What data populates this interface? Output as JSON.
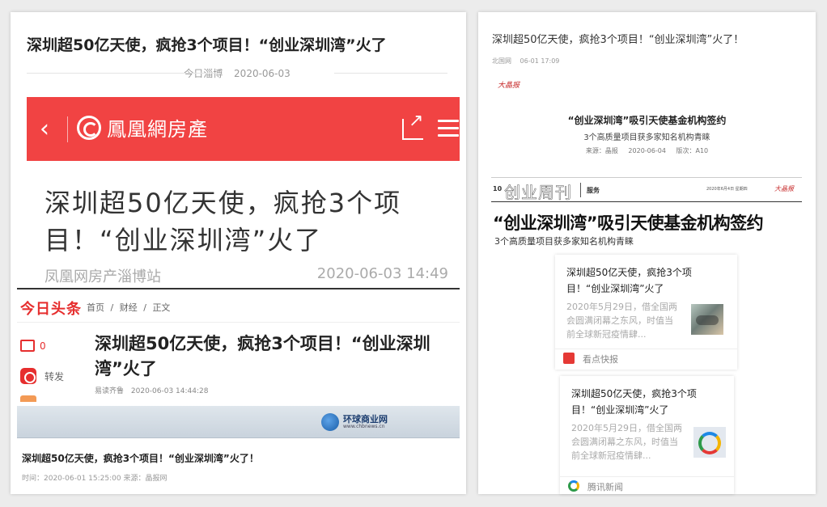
{
  "left": {
    "title": "深圳超50亿天使，疯抢3个项目！“创业深圳湾”火了",
    "source": "今日淄博",
    "date": "2020-06-03",
    "ifeng": {
      "brand": "鳳凰網房產",
      "headline": "深圳超50亿天使，疯抢3个项目！“创业深圳湾”火了",
      "source": "凤凰网房产淄博站",
      "time": "2020-06-03 14:49"
    },
    "toutiao": {
      "brand": "今日头条",
      "crumbs": [
        "首页",
        "/",
        "财经",
        "/",
        "正文"
      ],
      "comment_count": "0",
      "forward_label": "转发",
      "title": "深圳超50亿天使，疯抢3个项目！“创业深圳湾”火了",
      "source": "易读齐鲁",
      "time": "2020-06-03 14:44:28"
    },
    "huanqiu": {
      "logo_name": "环球商业网",
      "logo_url": "www.chbnews.cn",
      "title": "深圳超50亿天使，疯抢3个项目！“创业深圳湾”火了！",
      "meta": "时间：2020-06-01 15:25:00 来源：晶报网"
    }
  },
  "right": {
    "title": "深圳超50亿天使，疯抢3个项目！“创业深圳湾”火了！",
    "meta_source": "北国网",
    "meta_time": "06-01 17:09",
    "logo": "大晶报",
    "head": "“创业深圳湾”吸引天使基金机构签约",
    "sub": "3个高质量项目获多家知名机构青睐",
    "meta1_source": "来源：晶报",
    "meta1_date": "2020-06-04",
    "meta1_page": "版次：A10",
    "newspaper": {
      "page_no": "10",
      "column": "创业周刊",
      "tag": "服务",
      "date_line": "2020年6月4日 星期四",
      "logo": "大晶报",
      "head": "“创业深圳湾”吸引天使基金机构签约",
      "sub": "3个高质量项目获多家知名机构青睐"
    },
    "card_kd": {
      "title": "深圳超50亿天使，疯抢3个项目！“创业深圳湾”火了",
      "body": "2020年5月29日，借全国两会圆满闭幕之东风，时值当前全球新冠疫情肆...",
      "source": "看点快报"
    },
    "card_tx": {
      "title": "深圳超50亿天使，疯抢3个项目！“创业深圳湾”火了",
      "body": "2020年5月29日，借全国两会圆满闭幕之东风，时值当前全球新冠疫情肆...",
      "source": "腾讯新闻"
    }
  },
  "colors": {
    "ifeng_red": "#f14343",
    "toutiao_red": "#e62e2e"
  }
}
